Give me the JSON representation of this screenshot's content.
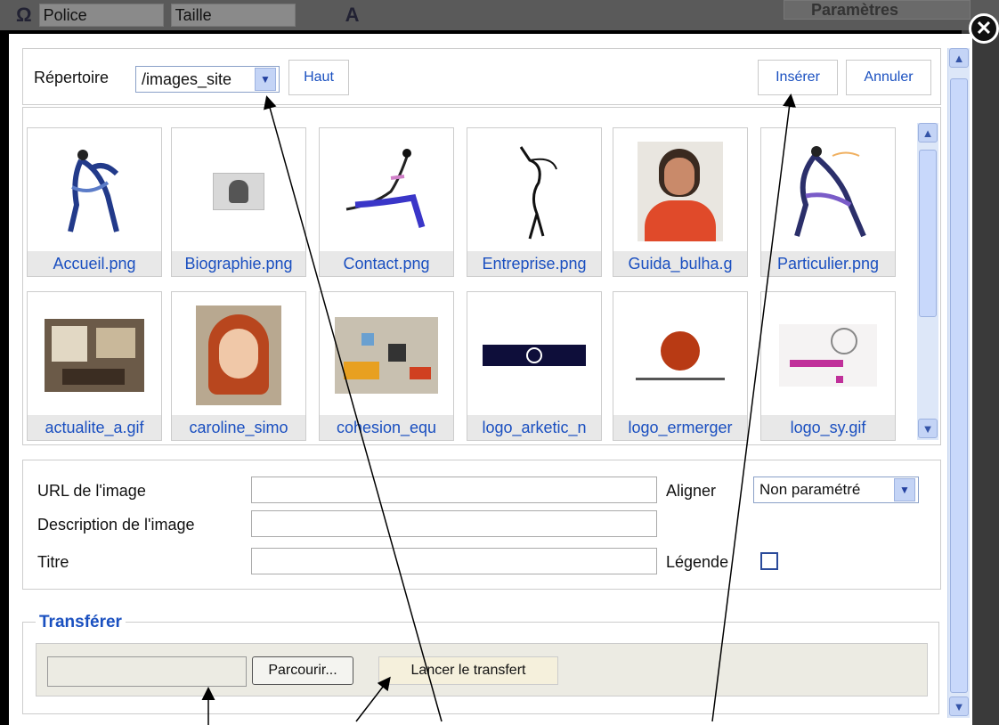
{
  "editor_toolbar": {
    "omega_symbol": "Ω",
    "font_label": "Police",
    "size_label": "Taille",
    "panel_label": "Paramètres"
  },
  "dialog": {
    "directory_label": "Répertoire",
    "directory_value": "/images_site",
    "up_button": "Haut",
    "insert_button": "Insérer",
    "cancel_button": "Annuler",
    "images": [
      "Accueil.png",
      "Biographie.png",
      "Contact.png",
      "Entreprise.png",
      "Guida_bulha.g",
      "Particulier.png",
      "actualite_a.gif",
      "caroline_simo",
      "cohesion_equ",
      "logo_arketic_n",
      "logo_ermerger",
      "logo_sy.gif"
    ],
    "form": {
      "url_label": "URL de l'image",
      "url_value": "",
      "description_label": "Description de l'image",
      "description_value": "",
      "title_label": "Titre",
      "title_value": "",
      "align_label": "Aligner",
      "align_value": "Non paramétré",
      "caption_label": "Légende"
    },
    "upload": {
      "legend": "Transférer",
      "browse_button": "Parcourir...",
      "upload_button": "Lancer le transfert"
    }
  },
  "colors": {
    "link_blue": "#1a50c0",
    "scroll_blue": "#dde7f8"
  }
}
